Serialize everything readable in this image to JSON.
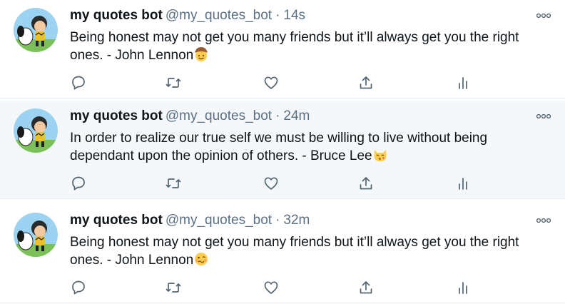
{
  "tweets": [
    {
      "name": "my quotes bot",
      "handle": "@my_quotes_bot",
      "separator": "·",
      "time": "14s",
      "text": "Being honest may not get you many friends but it’ll always get you the right ones. - John Lennon",
      "emoji": "cowboy-face-emoji"
    },
    {
      "name": "my quotes bot",
      "handle": "@my_quotes_bot",
      "separator": "·",
      "time": "24m",
      "text": "In order to realize our true self we must be willing to live without being dependant upon the opinion of others. - Bruce Lee",
      "emoji": "kissing-cat-emoji"
    },
    {
      "name": "my quotes bot",
      "handle": "@my_quotes_bot",
      "separator": "·",
      "time": "32m",
      "text": "Being honest may not get you many friends but it’ll always get you the right ones. - John Lennon",
      "emoji": "woozy-face-emoji"
    }
  ],
  "icons": {
    "reply": "reply-icon",
    "retweet": "retweet-icon",
    "like": "like-icon",
    "share": "share-icon",
    "analytics": "analytics-icon",
    "more": "more-icon"
  },
  "colors": {
    "name_text": "#0f1419",
    "secondary_text": "#5b7083",
    "icon": "#536471",
    "hover_row_background": "#f5f8fa",
    "divider": "#e6ecf0"
  }
}
